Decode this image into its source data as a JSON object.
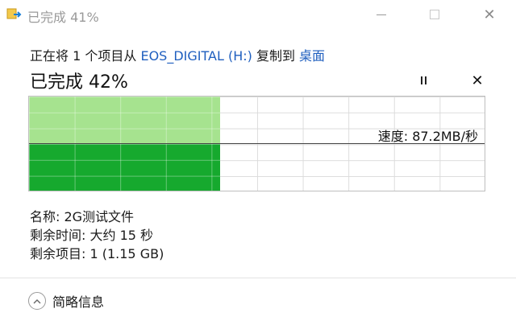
{
  "window": {
    "title": "已完成 41%"
  },
  "copy": {
    "prefix": "正在将 1 个项目从 ",
    "source": "EOS_DIGITAL (H:)",
    "middle": " 复制到 ",
    "destination": "桌面"
  },
  "progress": {
    "label": "已完成 42%",
    "percent": 42
  },
  "graph": {
    "speed_text": "速度: 87.2MB/秒"
  },
  "details": {
    "name": "名称: 2G测试文件",
    "time_remaining": "剩余时间: 大约 15 秒",
    "items_remaining": "剩余项目: 1 (1.15 GB)"
  },
  "footer": {
    "more_label": "简略信息"
  },
  "colors": {
    "fill_light": "#a6e38f",
    "fill_dark": "#16a92e",
    "link": "#1f5fbf"
  },
  "icons": {
    "app": "copy-arrow-icon",
    "pause": "pause-icon",
    "cancel": "close-icon",
    "collapse": "chevron-up-icon"
  }
}
